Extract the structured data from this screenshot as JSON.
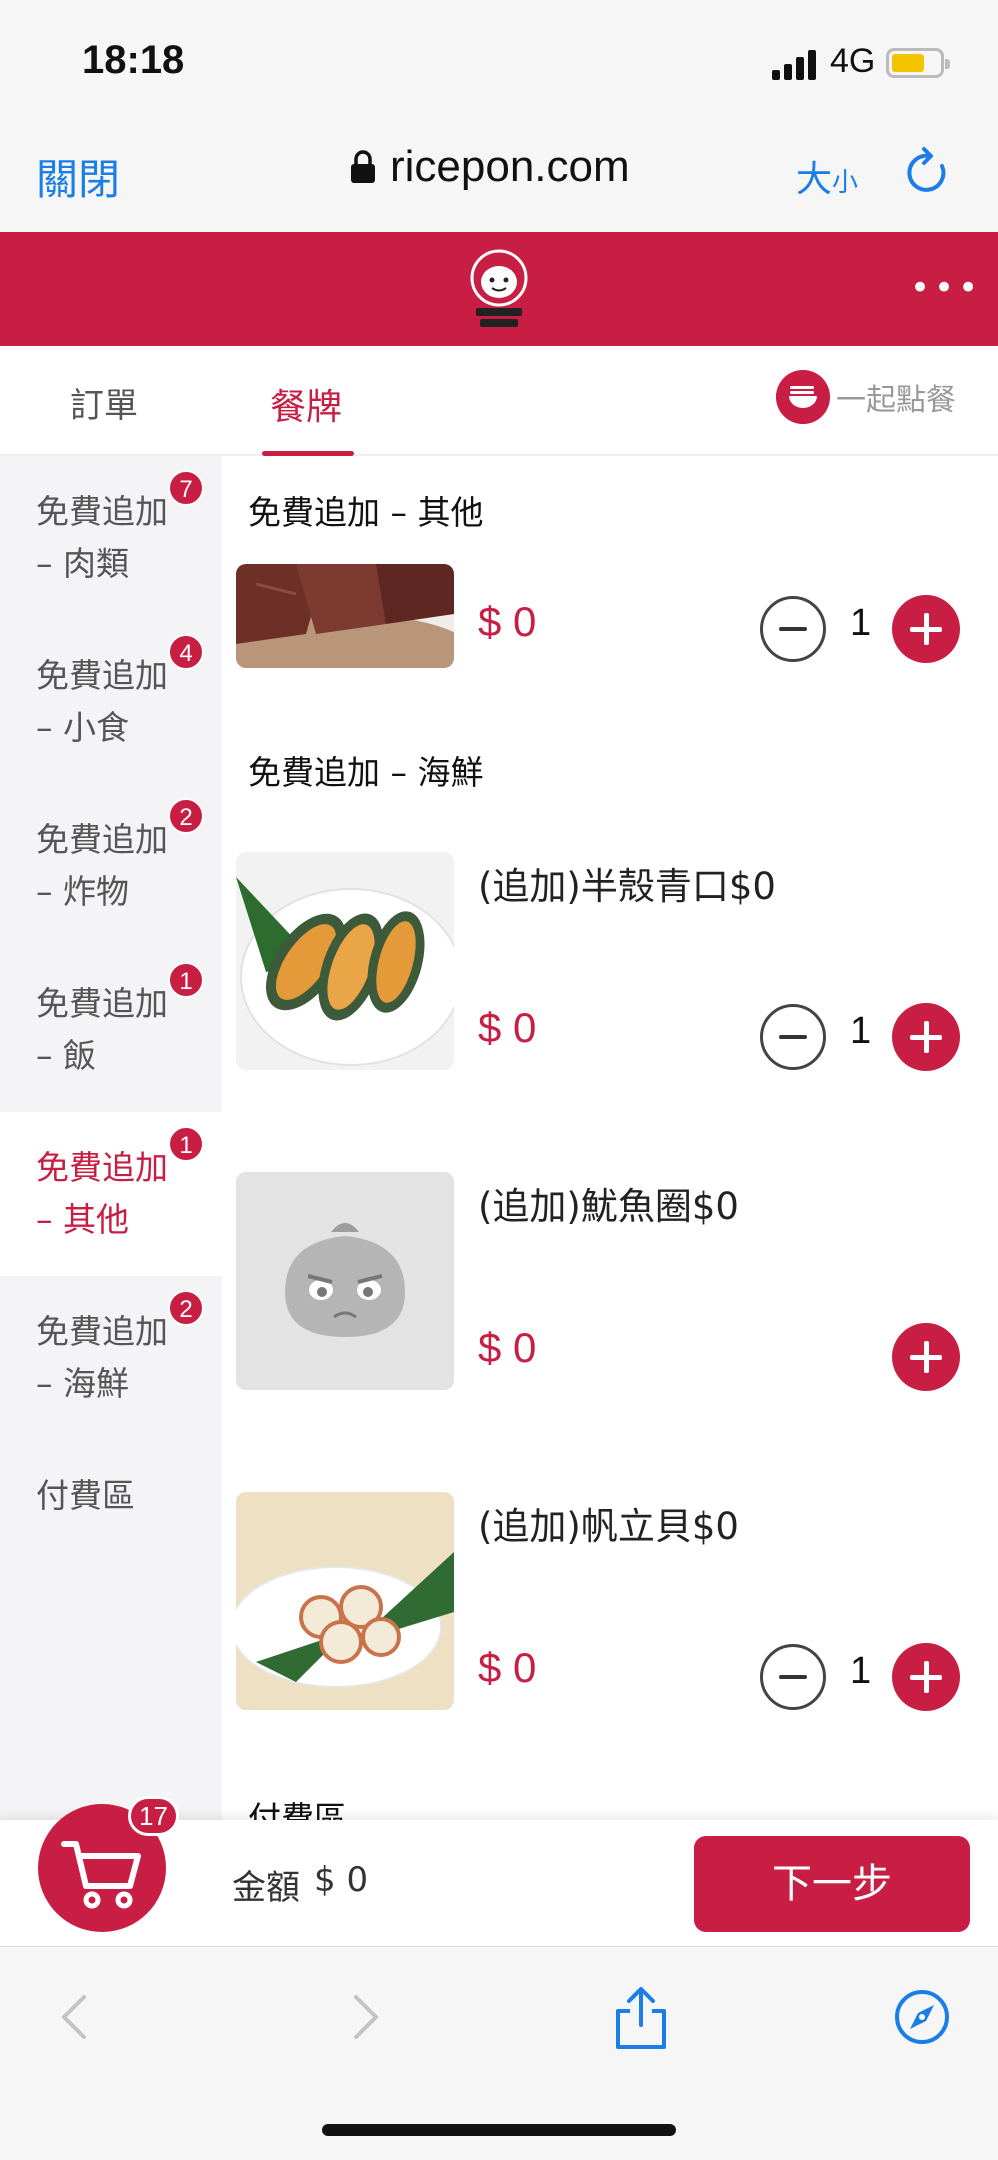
{
  "status_bar": {
    "time": "18:18",
    "network": "4G"
  },
  "browser": {
    "close_label": "關閉",
    "url": "ricepon.com",
    "size_label_big": "大",
    "size_label_small": "小"
  },
  "tabs": {
    "order": "訂單",
    "menu": "餐牌",
    "together": "一起點餐"
  },
  "sidebar": {
    "items": [
      {
        "line1": "免費追加",
        "line2": "– 肉類",
        "badge": "7"
      },
      {
        "line1": "免費追加",
        "line2": "– 小食",
        "badge": "4"
      },
      {
        "line1": "免費追加",
        "line2": "– 炸物",
        "badge": "2"
      },
      {
        "line1": "免費追加",
        "line2": "– 飯",
        "badge": "1"
      },
      {
        "line1": "免費追加",
        "line2": "– 其他",
        "badge": "1"
      },
      {
        "line1": "免費追加",
        "line2": "– 海鮮",
        "badge": "2"
      },
      {
        "line1": "付費區",
        "line2": "",
        "badge": ""
      }
    ]
  },
  "main": {
    "sections": [
      {
        "title": "免費追加 – 其他"
      },
      {
        "title": "免費追加 – 海鮮"
      },
      {
        "title": "付費區"
      }
    ],
    "items": [
      {
        "name": "",
        "price": "$ 0",
        "qty": "1"
      },
      {
        "name": "(追加)半殼青口$0",
        "price": "$ 0",
        "qty": "1"
      },
      {
        "name": "(追加)魷魚圈$0",
        "price": "$ 0",
        "qty": ""
      },
      {
        "name": "(追加)帆立貝$0",
        "price": "$ 0",
        "qty": "1"
      }
    ]
  },
  "order_bar": {
    "cart_count": "17",
    "amount_label": "金額",
    "amount_value": "$ 0",
    "next_label": "下一步"
  },
  "colors": {
    "brand": "#c81e44",
    "link": "#1a7ee6"
  }
}
